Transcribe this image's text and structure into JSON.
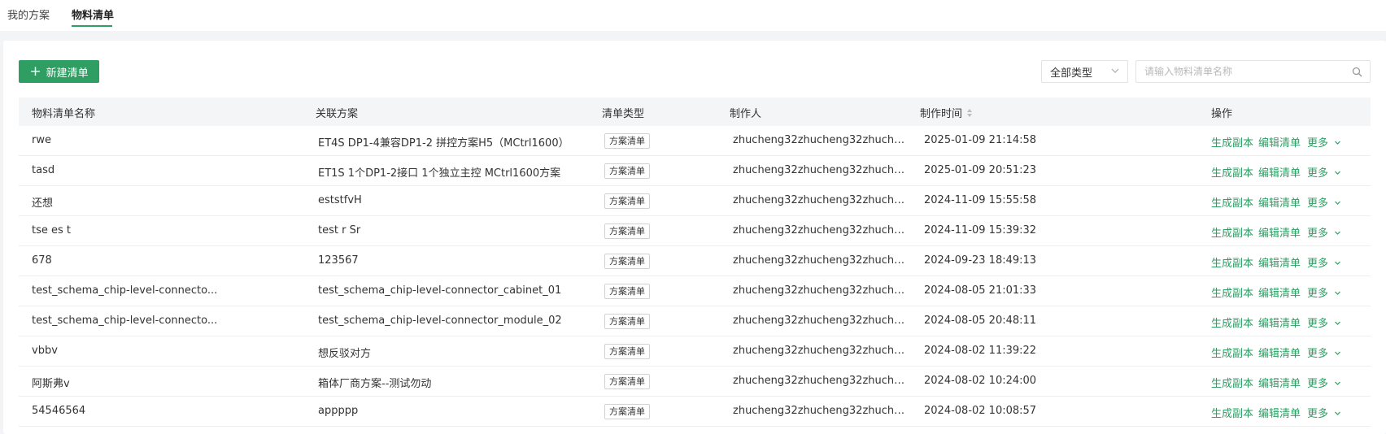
{
  "tabs": [
    {
      "label": "我的方案"
    },
    {
      "label": "物料清单"
    }
  ],
  "toolbar": {
    "new_button_label": "新建清单",
    "type_select_value": "全部类型",
    "search_placeholder": "请输入物料清单名称"
  },
  "columns": {
    "name": "物料清单名称",
    "plan": "关联方案",
    "type": "清单类型",
    "creator": "制作人",
    "time": "制作时间",
    "ops": "操作"
  },
  "actions": {
    "copy": "生成副本",
    "edit": "编辑清单",
    "more": "更多"
  },
  "rows": [
    {
      "name": "rwe",
      "plan": "ET4S DP1-4兼容DP1-2 拼控方案H5（MCtrl1600）",
      "type": "方案清单",
      "creator": "zhucheng32zhucheng32zhuche...",
      "time": "2025-01-09 21:14:58"
    },
    {
      "name": "tasd",
      "plan": "ET1S 1个DP1-2接口 1个独立主控 MCtrl1600方案",
      "type": "方案清单",
      "creator": "zhucheng32zhucheng32zhuche...",
      "time": "2025-01-09 20:51:23"
    },
    {
      "name": "还想",
      "plan": "eststfvH",
      "type": "方案清单",
      "creator": "zhucheng32zhucheng32zhuche...",
      "time": "2024-11-09 15:55:58"
    },
    {
      "name": "tse es t",
      "plan": "test r Sr",
      "type": "方案清单",
      "creator": "zhucheng32zhucheng32zhuche...",
      "time": "2024-11-09 15:39:32"
    },
    {
      "name": "678",
      "plan": "123567",
      "type": "方案清单",
      "creator": "zhucheng32zhucheng32zhuche...",
      "time": "2024-09-23 18:49:13"
    },
    {
      "name": "test_schema_chip-level-connecto...",
      "plan": "test_schema_chip-level-connector_cabinet_01",
      "type": "方案清单",
      "creator": "zhucheng32zhucheng32zhuche...",
      "time": "2024-08-05 21:01:33"
    },
    {
      "name": "test_schema_chip-level-connecto...",
      "plan": "test_schema_chip-level-connector_module_02",
      "type": "方案清单",
      "creator": "zhucheng32zhucheng32zhuche...",
      "time": "2024-08-05 20:48:11"
    },
    {
      "name": "vbbv",
      "plan": "想反驳对方",
      "type": "方案清单",
      "creator": "zhucheng32zhucheng32zhuche...",
      "time": "2024-08-02 11:39:22"
    },
    {
      "name": "阿斯弗v",
      "plan": "箱体厂商方案--测试勿动",
      "type": "方案清单",
      "creator": "zhucheng32zhucheng32zhuche...",
      "time": "2024-08-02 10:24:00"
    },
    {
      "name": "54546564",
      "plan": "appppp",
      "type": "方案清单",
      "creator": "zhucheng32zhucheng32zhuche...",
      "time": "2024-08-02 10:08:57"
    }
  ],
  "icons": {
    "add": "plus-icon",
    "select": "chevron-down-icon",
    "search": "search-icon",
    "sort": "sort-icon"
  },
  "colors": {
    "accent": "#2e9e63",
    "header_bg": "#f4f5f7",
    "page_bg": "#f3f4f6"
  }
}
